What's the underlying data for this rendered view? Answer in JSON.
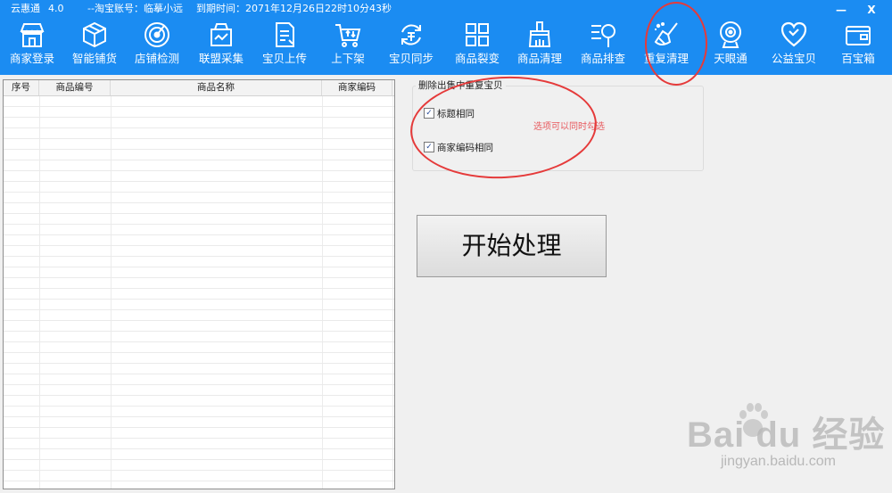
{
  "title_bar": {
    "app_name": "云惠通",
    "version": "4.0",
    "account": "--淘宝账号：临摹小远",
    "expiry": "到期时间：2071年12月26日22时10分43秒",
    "minimize": "—",
    "close": "X"
  },
  "toolbar": [
    {
      "label": "商家登录",
      "icon": "store-icon"
    },
    {
      "label": "智能铺货",
      "icon": "box-icon"
    },
    {
      "label": "店铺检测",
      "icon": "radar-icon"
    },
    {
      "label": "联盟采集",
      "icon": "basket-icon"
    },
    {
      "label": "宝贝上传",
      "icon": "document-icon"
    },
    {
      "label": "上下架",
      "icon": "cart-icon"
    },
    {
      "label": "宝贝同步",
      "icon": "sync-icon"
    },
    {
      "label": "商品裂变",
      "icon": "grid-icon"
    },
    {
      "label": "商品清理",
      "icon": "brush-icon"
    },
    {
      "label": "商品排查",
      "icon": "search-list-icon"
    },
    {
      "label": "重复清理",
      "icon": "broom-icon"
    },
    {
      "label": "天眼通",
      "icon": "camera-icon"
    },
    {
      "label": "公益宝贝",
      "icon": "heart-icon"
    },
    {
      "label": "百宝箱",
      "icon": "wallet-icon"
    }
  ],
  "table": {
    "columns": [
      "序号",
      "商品编号",
      "商品名称",
      "商家编码"
    ],
    "rows": []
  },
  "options": {
    "group_title": "删除出售中重复宝贝",
    "same_title": {
      "label": "标题相同",
      "checked": true
    },
    "same_code": {
      "label": "商家编码相同",
      "checked": true
    },
    "note": "选项可以同时勾选"
  },
  "start_button": "开始处理",
  "watermark": {
    "brand": "Bai du 经验",
    "url": "jingyan.baidu.com"
  },
  "colors": {
    "toolbar_bg": "#1b8cf2",
    "annotation_red": "#e53a3a",
    "note_red": "#e8595d"
  }
}
